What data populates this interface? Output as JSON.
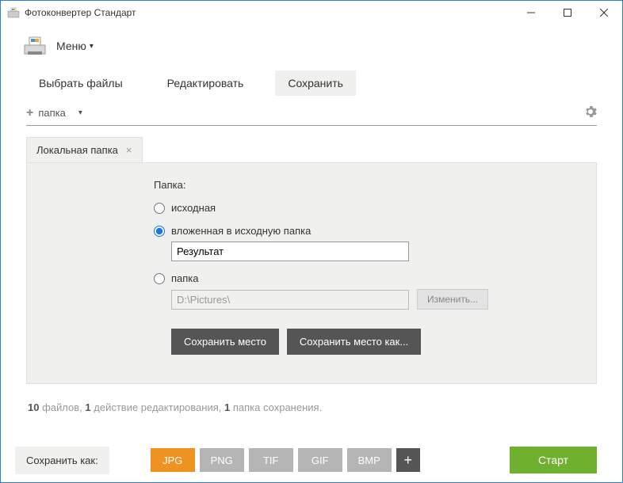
{
  "titlebar": {
    "title": "Фотоконвертер Стандарт"
  },
  "menu": {
    "label": "Меню"
  },
  "tabs": {
    "select_files": "Выбрать файлы",
    "edit": "Редактировать",
    "save": "Сохранить"
  },
  "toolbar": {
    "folder_label": "папка"
  },
  "subtab": {
    "label": "Локальная папка"
  },
  "panel": {
    "folder_label": "Папка:",
    "radio_source": "исходная",
    "radio_nested": "вложенная в исходную папка",
    "nested_value": "Результат",
    "radio_custom": "папка",
    "custom_path": "D:\\Pictures\\",
    "change_btn": "Изменить...",
    "save_loc": "Сохранить место",
    "save_loc_as": "Сохранить место как..."
  },
  "status": {
    "file_count": "10",
    "files_word": "файлов,",
    "action_count": "1",
    "action_word": "действие редактирования,",
    "folder_count": "1",
    "folder_word": "папка сохранения."
  },
  "bottom": {
    "save_as": "Сохранить как:",
    "formats": {
      "jpg": "JPG",
      "png": "PNG",
      "tif": "TIF",
      "gif": "GIF",
      "bmp": "BMP"
    },
    "start": "Старт"
  }
}
